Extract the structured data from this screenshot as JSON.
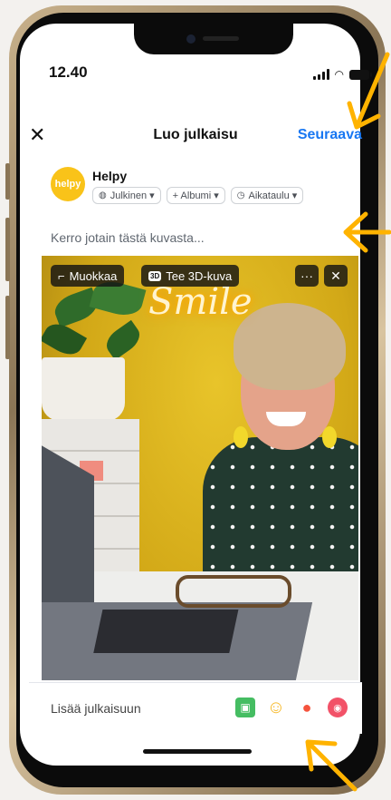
{
  "status": {
    "time": "12.40"
  },
  "nav": {
    "close": "✕",
    "title": "Luo julkaisu",
    "next": "Seuraava"
  },
  "author": {
    "avatar_text": "helpy",
    "name": "Helpy",
    "pills": [
      {
        "icon": "globe-icon",
        "label": "Julkinen ▾"
      },
      {
        "icon": "plus-icon",
        "label": "+ Albumi ▾"
      },
      {
        "icon": "clock-icon",
        "label": "Aikataulu ▾"
      }
    ]
  },
  "caption_placeholder": "Kerro jotain tästä kuvasta...",
  "photo": {
    "edit_label": "Muokkaa",
    "threed_badge": "3D",
    "threed_label": "Tee 3D-kuva",
    "more": "···",
    "remove": "✕",
    "neon_text": "Smile"
  },
  "addbar": {
    "label": "Lisää julkaisuun",
    "icons": [
      "photo-icon",
      "emoji-icon",
      "location-icon",
      "gif-icon"
    ]
  },
  "colors": {
    "accent": "#1877f2",
    "neon_arrow": "#ffb300",
    "avatar": "#f9c319"
  }
}
